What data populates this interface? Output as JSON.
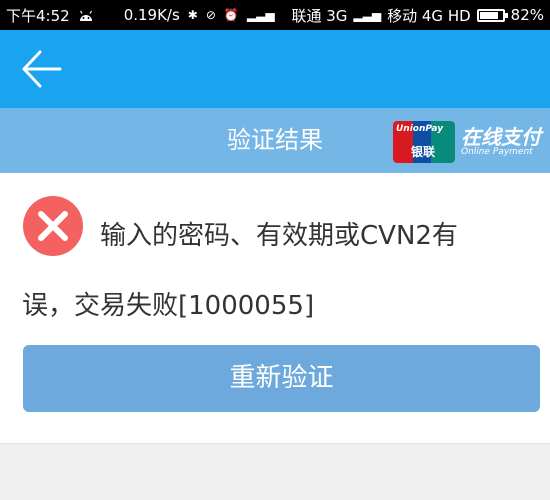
{
  "status_bar": {
    "time": "下午4:52",
    "speed": "0.19K/s",
    "carrier1": "联通 3G",
    "carrier2": "移动 4G HD",
    "battery": "82%",
    "battery_level": 0.82
  },
  "header": {
    "back_icon": "back-arrow-icon"
  },
  "sub_header": {
    "title": "验证结果",
    "logo_en": "UnionPay",
    "logo_cn": "银联",
    "online_cn": "在线支付",
    "online_en": "Online Payment"
  },
  "message": {
    "icon": "close-icon",
    "line1": "输入的密码、有效期或CVN2有",
    "line2": "误，交易失败[1000055]"
  },
  "actions": {
    "retry": "重新验证"
  },
  "colors": {
    "app_bar": "#1aa3ef",
    "sub_header": "#74b6e6",
    "error": "#f36161",
    "button": "#6da9dc"
  }
}
